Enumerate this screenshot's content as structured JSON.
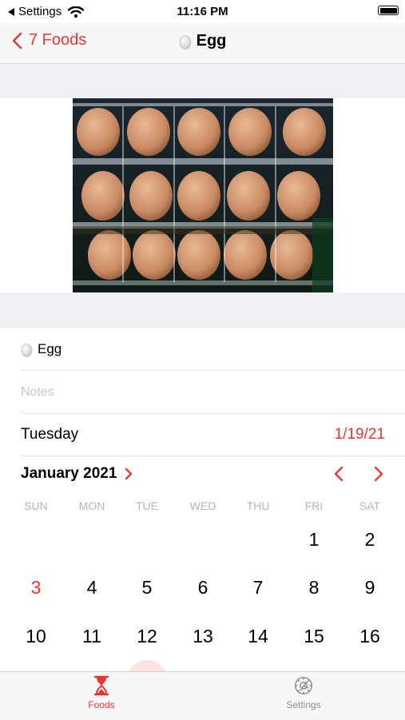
{
  "status_bar": {
    "back_app": "Settings",
    "time": "11:16 PM"
  },
  "nav": {
    "back_label": "7 Foods",
    "title": "Egg"
  },
  "food": {
    "name": "Egg",
    "notes_value": "",
    "notes_placeholder": "Notes"
  },
  "date_row": {
    "weekday": "Tuesday",
    "value": "1/19/21"
  },
  "calendar": {
    "month_label": "January 2021",
    "weekdays": [
      "SUN",
      "MON",
      "TUE",
      "WED",
      "THU",
      "FRI",
      "SAT"
    ],
    "rows": [
      [
        "",
        "",
        "",
        "",
        "",
        "1",
        "2"
      ],
      [
        "3",
        "4",
        "5",
        "6",
        "7",
        "8",
        "9"
      ],
      [
        "10",
        "11",
        "12",
        "13",
        "14",
        "15",
        "16"
      ]
    ],
    "highlighted_day": "3"
  },
  "tabs": [
    {
      "label": "Foods",
      "icon": "hourglass-icon",
      "active": true
    },
    {
      "label": "Settings",
      "icon": "gear-icon",
      "active": false
    }
  ],
  "colors": {
    "accent": "#e53935",
    "muted": "#8e8e93",
    "background_band": "#efeff4"
  }
}
